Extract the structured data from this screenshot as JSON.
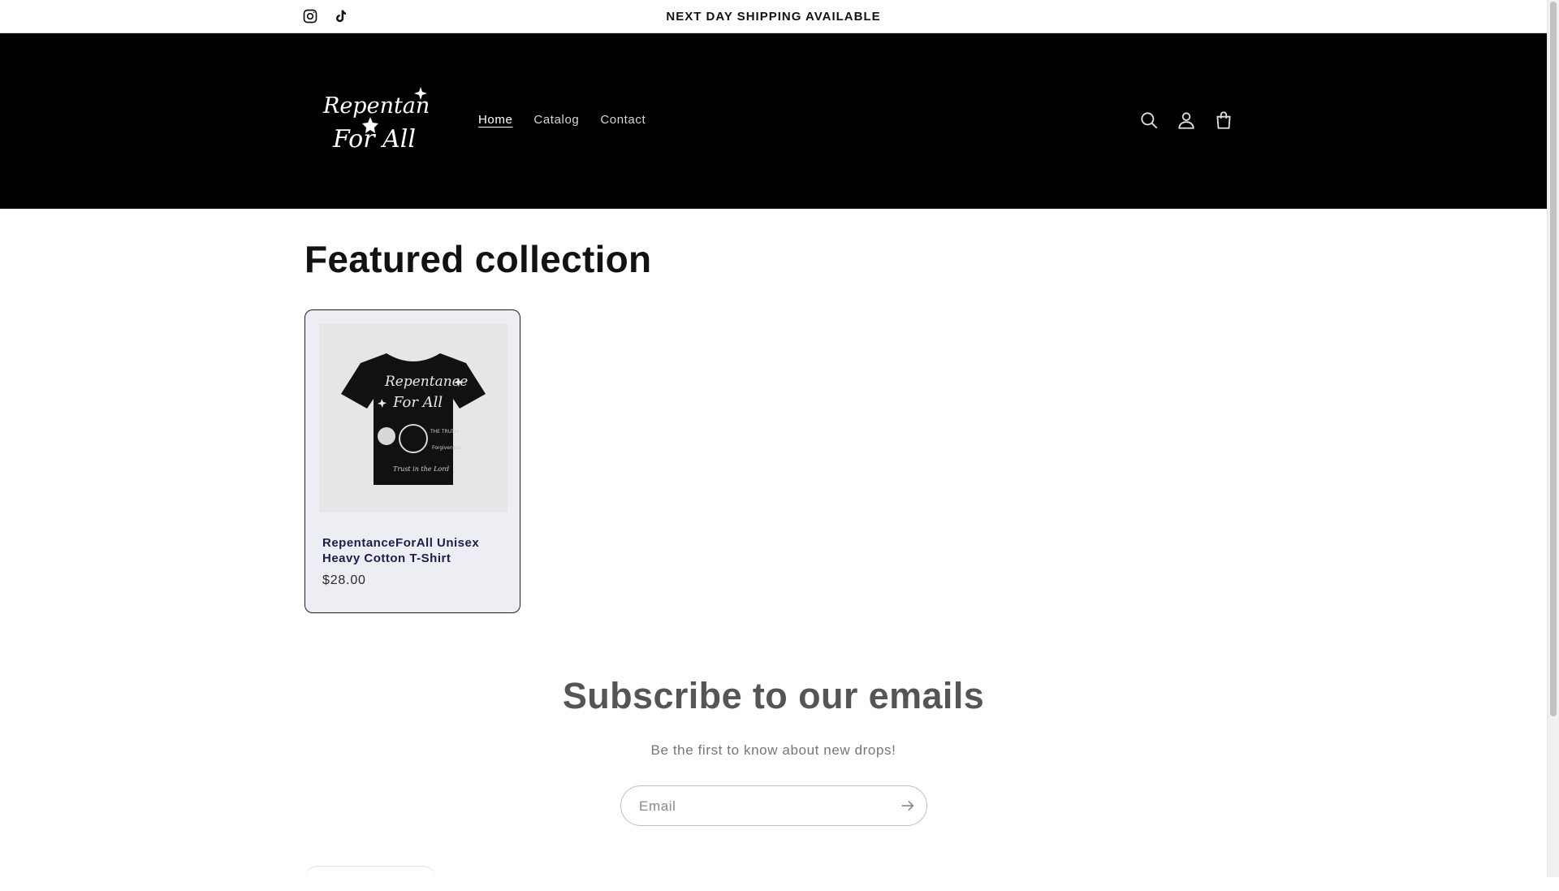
{
  "announcement": {
    "text": "NEXT DAY SHIPPING AVAILABLE",
    "social": [
      {
        "name": "instagram-icon"
      },
      {
        "name": "tiktok-icon"
      }
    ]
  },
  "header": {
    "logo": {
      "line1": "Repentance",
      "line2": "For All"
    },
    "nav": [
      {
        "label": "Home",
        "active": true
      },
      {
        "label": "Catalog",
        "active": false
      },
      {
        "label": "Contact",
        "active": false
      }
    ],
    "icons": [
      "search-icon",
      "account-icon",
      "cart-icon"
    ]
  },
  "featured": {
    "title": "Featured collection",
    "products": [
      {
        "title": "RepentanceForAll Unisex Heavy Cotton T-Shirt",
        "price": "$28.00",
        "image_icon": "tshirt-image"
      }
    ]
  },
  "newsletter": {
    "title": "Subscribe to our emails",
    "text": "Be the first to know about new drops!",
    "email_placeholder": "Email",
    "submit_icon": "arrow-right-icon"
  },
  "colors": {
    "header_bg": "#000000",
    "card_bg": "#eceef3",
    "product_title": "#1c1d4a"
  }
}
